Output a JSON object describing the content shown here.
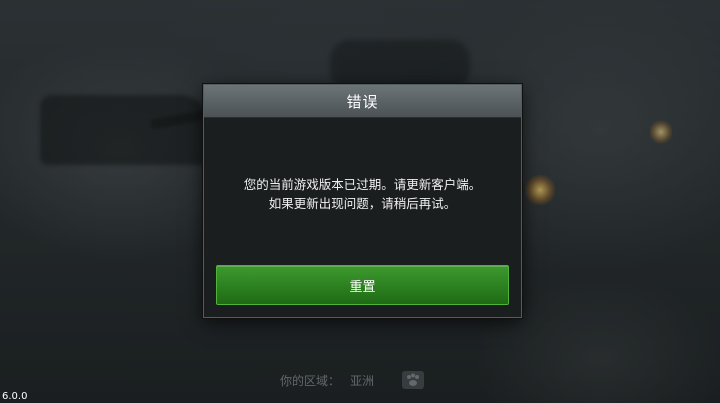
{
  "dialog": {
    "title": "错误",
    "message_line1": "您的当前游戏版本已过期。请更新客户端。",
    "message_line2": "如果更新出现问题，请稍后再试。",
    "reset_label": "重置"
  },
  "footer": {
    "region_label": "你的区域：",
    "region_value": "亚洲",
    "region_icon": "paw-icon"
  },
  "version": "6.0.0",
  "colors": {
    "button_green": "#2e8a22",
    "dialog_bg": "#1b1e1f",
    "header_gray": "#5c6367"
  }
}
